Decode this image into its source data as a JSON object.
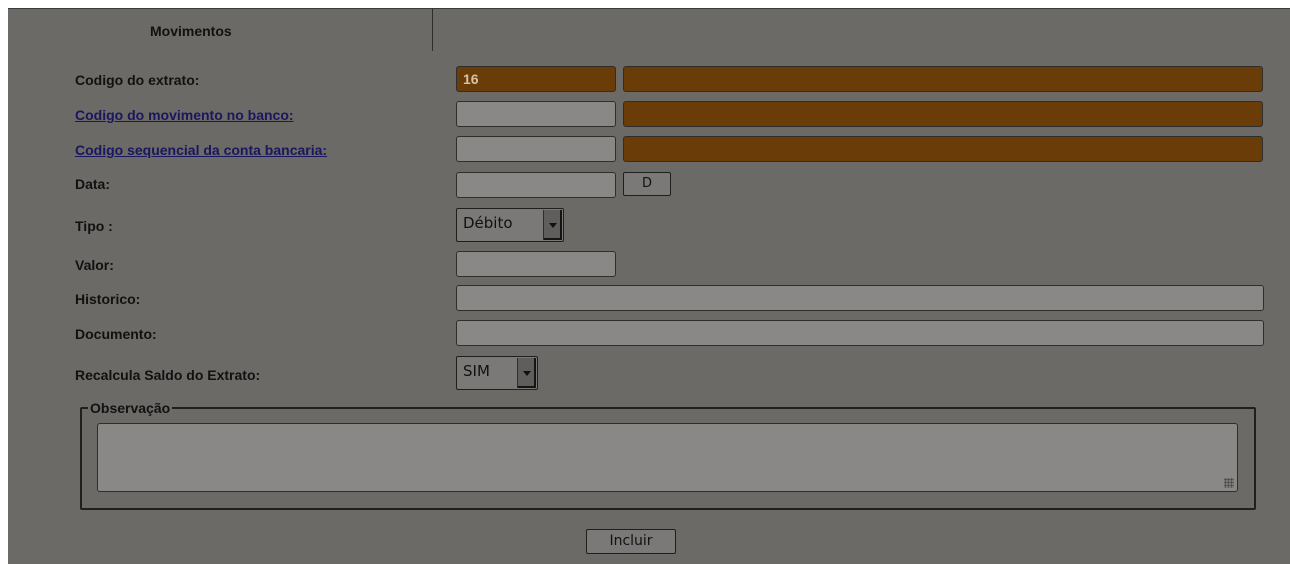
{
  "tab": {
    "label": "Movimentos"
  },
  "fields": {
    "codigo_extrato": {
      "label": "Codigo do extrato:",
      "value": "16",
      "extra": ""
    },
    "codigo_movimento": {
      "label": "Codigo do movimento no banco:",
      "value": "",
      "extra": ""
    },
    "codigo_sequencial": {
      "label": "Codigo sequencial da conta bancaria:",
      "value": "",
      "extra": ""
    },
    "data": {
      "label": "Data:",
      "value": "",
      "button": "D"
    },
    "tipo": {
      "label": "Tipo :",
      "selected": "Débito"
    },
    "valor": {
      "label": "Valor:",
      "value": ""
    },
    "historico": {
      "label": "Historico:",
      "value": ""
    },
    "documento": {
      "label": "Documento:",
      "value": ""
    },
    "recalcula": {
      "label": "Recalcula Saldo do Extrato:",
      "selected": "SIM"
    }
  },
  "observacao": {
    "legend": "Observação",
    "value": ""
  },
  "actions": {
    "incluir": "Incluir"
  },
  "colors": {
    "panel": "#6b6a67",
    "highlight_field": "#6a3c08",
    "link": "#1a1660"
  }
}
